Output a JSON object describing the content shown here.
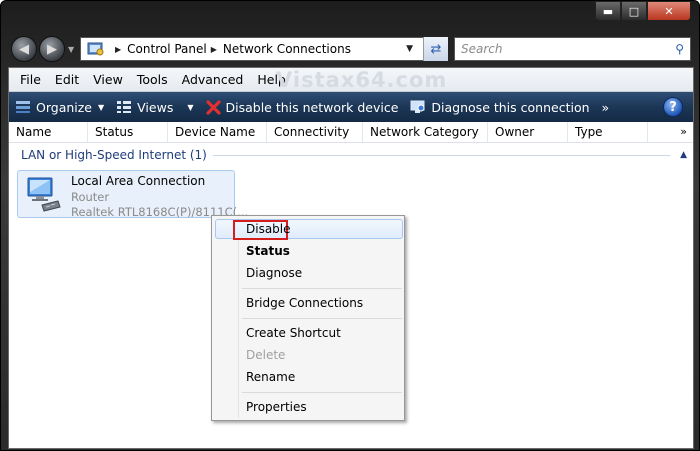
{
  "address": {
    "crumbs": [
      "Control Panel",
      "Network Connections"
    ]
  },
  "search": {
    "placeholder": "Search"
  },
  "menu": [
    "File",
    "Edit",
    "View",
    "Tools",
    "Advanced",
    "Help"
  ],
  "watermark": "Vistax64.com",
  "toolbar": {
    "organize": "Organize",
    "views": "Views",
    "disable": "Disable this network device",
    "diagnose": "Diagnose this connection",
    "more": "»",
    "help": "?"
  },
  "columns": [
    "Name",
    "Status",
    "Device Name",
    "Connectivity",
    "Network Category",
    "Owner",
    "Type"
  ],
  "columns_more": "»",
  "group": {
    "label": "LAN or High-Speed Internet (1)"
  },
  "connection": {
    "name": "Local Area Connection",
    "type": "Router",
    "device": "Realtek RTL8168C(P)/8111C(..."
  },
  "context_menu": {
    "items": [
      "Disable",
      "Status",
      "Diagnose",
      "Bridge Connections",
      "Create Shortcut",
      "Delete",
      "Rename",
      "Properties"
    ]
  },
  "colors": {
    "toolbar": "#1c3656",
    "highlight_border": "#d61d1d",
    "group_text": "#1e3c7a"
  }
}
